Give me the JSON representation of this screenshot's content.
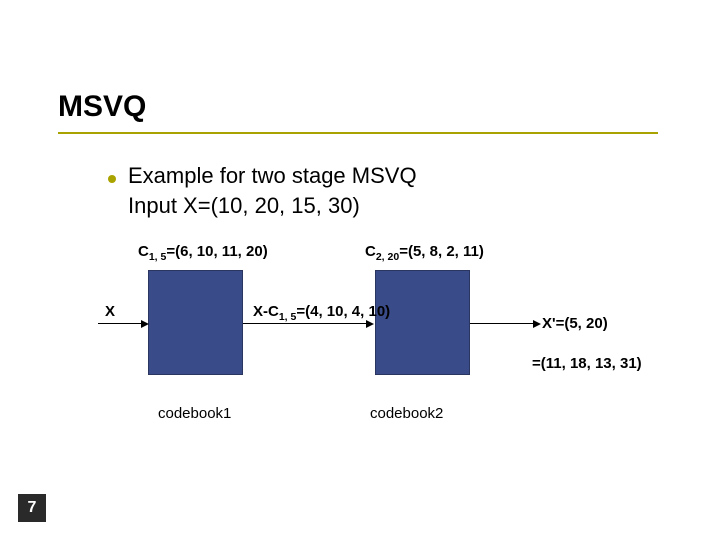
{
  "slide": {
    "title": "MSVQ",
    "bullet1": "Example for two stage MSVQ",
    "bullet2": "Input X=(10, 20, 15, 30)",
    "page": "7"
  },
  "labels": {
    "c1": "=(6, 10, 11, 20)",
    "c1_prefix": "C",
    "c1_sub": "1, 5",
    "c2": "=(5, 8, 2, 11)",
    "c2_prefix": "C",
    "c2_sub": "2, 20",
    "x": "X",
    "diff_prefix": "X-C",
    "diff_sub": "1, 5",
    "diff": "=(4, 10, 4, 10)",
    "xprime": "X'=(5, 20)",
    "sum": "=(11, 18, 13, 31)",
    "cb1": "codebook1",
    "cb2": "codebook2"
  },
  "chart_data": {
    "type": "table",
    "title": "Two-stage MSVQ example",
    "input_X": [
      10,
      20,
      15,
      30
    ],
    "stage1_codeword_index": "1,5",
    "stage1_codeword_C": [
      6,
      10,
      11,
      20
    ],
    "residual_X_minus_C": [
      4,
      10,
      4,
      10
    ],
    "stage2_codeword_index": "2,20",
    "stage2_codeword_C": [
      5,
      8,
      2,
      11
    ],
    "output_Xprime": [
      5,
      20
    ],
    "reconstruction_sum": [
      11,
      18,
      13,
      31
    ]
  }
}
